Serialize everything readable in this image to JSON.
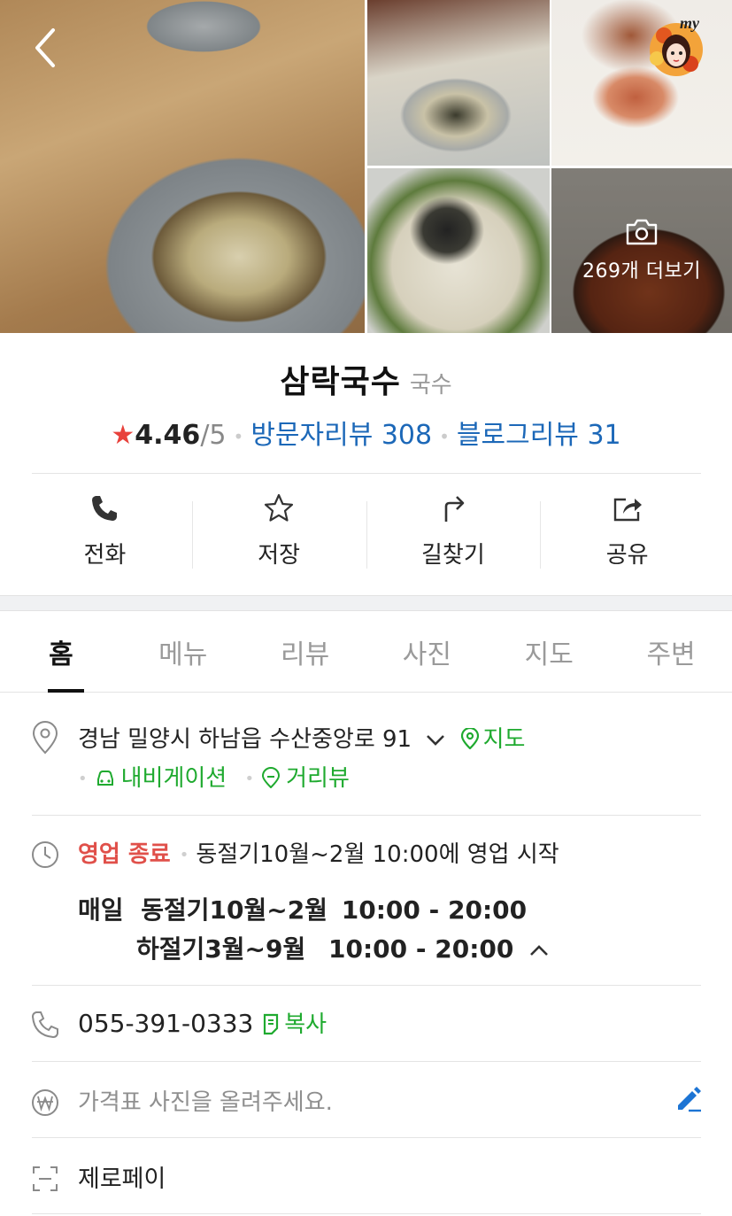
{
  "gallery": {
    "more_label": "269개 더보기",
    "icons": {
      "back": "chevron-left-icon",
      "camera": "camera-icon",
      "avatar": "my-avatar-badge"
    }
  },
  "place": {
    "name": "삼락국수",
    "category": "국수",
    "rating": "4.46",
    "rating_max": "/5",
    "visitor_review": "방문자리뷰 308",
    "blog_review": "블로그리뷰 31",
    "star_color": "#e8413b",
    "link_color": "#1c68b8"
  },
  "actions": [
    {
      "label": "전화",
      "icon": "phone-icon"
    },
    {
      "label": "저장",
      "icon": "star-icon"
    },
    {
      "label": "길찾기",
      "icon": "directions-icon"
    },
    {
      "label": "공유",
      "icon": "share-icon"
    }
  ],
  "tabs": [
    "홈",
    "메뉴",
    "리뷰",
    "사진",
    "지도",
    "주변"
  ],
  "active_tab": "홈",
  "info": {
    "address": "경남 밀양시 하남읍 수산중앙로 91",
    "map_link": "지도",
    "navigation_link": "내비게이션",
    "streetview_link": "거리뷰",
    "status": "영업 종료",
    "status_note": "동절기10월~2월 10:00에 영업 시작",
    "hours_day": "매일",
    "hours_winter_label": "동절기10월~2월",
    "hours_winter_time": "10:00 - 20:00",
    "hours_summer_label": "하절기3월~9월",
    "hours_summer_time": "10:00 - 20:00",
    "phone": "055-391-0333",
    "copy_label": "복사",
    "price_placeholder": "가격표 사진을 올려주세요.",
    "zeropay": "제로페이",
    "accent_green": "#1faa2f",
    "closed_color": "#e0504a"
  }
}
